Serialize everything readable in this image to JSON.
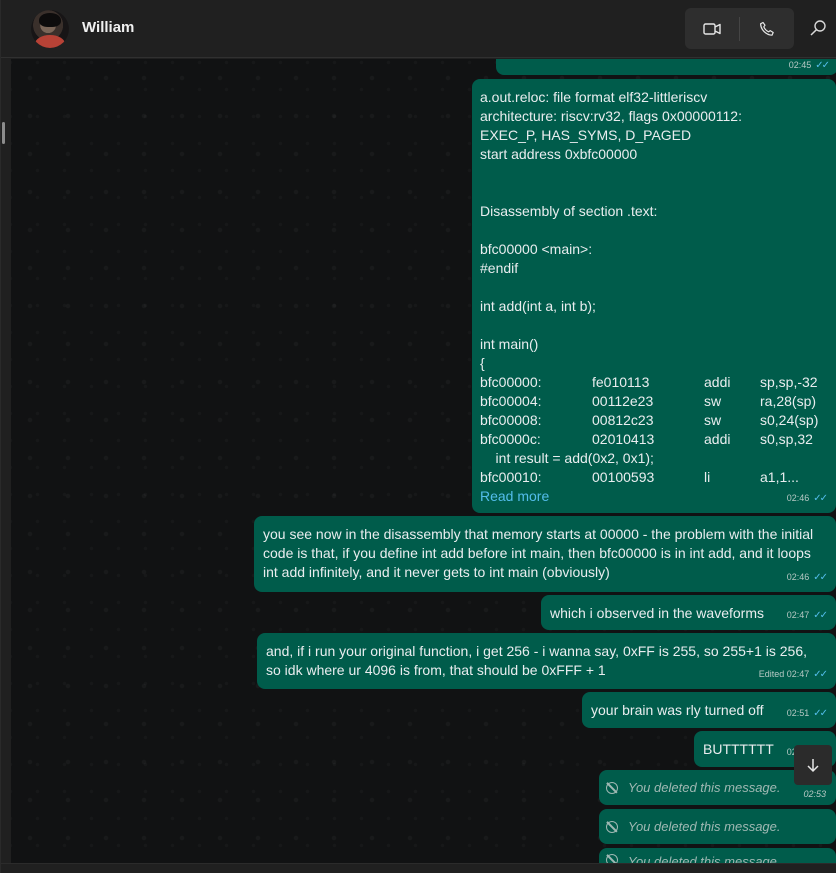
{
  "header": {
    "contact_name": "William",
    "icons": [
      "video-icon",
      "phone-icon",
      "search-icon"
    ]
  },
  "messages": {
    "top_partial_time": "02:45",
    "code": {
      "lines": [
        "a.out.reloc:     file format elf32-littleriscv",
        "architecture: riscv:rv32, flags 0x00000112:",
        "EXEC_P, HAS_SYMS, D_PAGED",
        "start address 0xbfc00000",
        "",
        "",
        "Disassembly of section .text:",
        "",
        "bfc00000 <main>:",
        "#endif",
        "",
        "int add(int a, int b);",
        "",
        "int main()",
        "{"
      ],
      "asm_rows": [
        {
          "addr": "bfc00000:",
          "hex": "fe010113",
          "op": "addi",
          "args": "sp,sp,-32"
        },
        {
          "addr": "bfc00004:",
          "hex": "00112e23",
          "op": "sw",
          "args": "ra,28(sp)"
        },
        {
          "addr": "bfc00008:",
          "hex": "00812c23",
          "op": "sw",
          "args": "s0,24(sp)"
        },
        {
          "addr": "bfc0000c:",
          "hex": "02010413",
          "op": "addi",
          "args": "s0,sp,32"
        }
      ],
      "source_line": "    int result = add(0x2, 0x1);",
      "last_row": {
        "addr": "bfc00010:",
        "hex": "00100593",
        "op": "li",
        "args": "a1,1..."
      },
      "read_more": "Read more",
      "time": "02:46"
    },
    "msg1": {
      "text": "you see now in the disassembly that memory starts at 00000 - the problem with the initial code is that, if you define int add before int main, then bfc00000 is in int add, and it loops int add infinitely, and it never gets to int main (obviously)",
      "time": "02:46"
    },
    "msg2": {
      "text": "which i observed in the waveforms",
      "time": "02:47"
    },
    "msg3": {
      "text": "and, if i run your original function, i get 256 - i wanna say, 0xFF is 255, so 255+1 is 256, so idk where ur 4096 is from, that should be 0xFFF + 1",
      "time": "Edited 02:47"
    },
    "msg4": {
      "text": "your brain was rly turned off",
      "time": "02:51"
    },
    "msg5": {
      "text": "BUTTTTTT",
      "time": "02:53"
    },
    "deleted": [
      {
        "text": "You deleted this message.",
        "time": "02:53"
      },
      {
        "text": "You deleted this message.",
        "time": ""
      },
      {
        "text": "You deleted this message.",
        "time": ""
      }
    ]
  }
}
